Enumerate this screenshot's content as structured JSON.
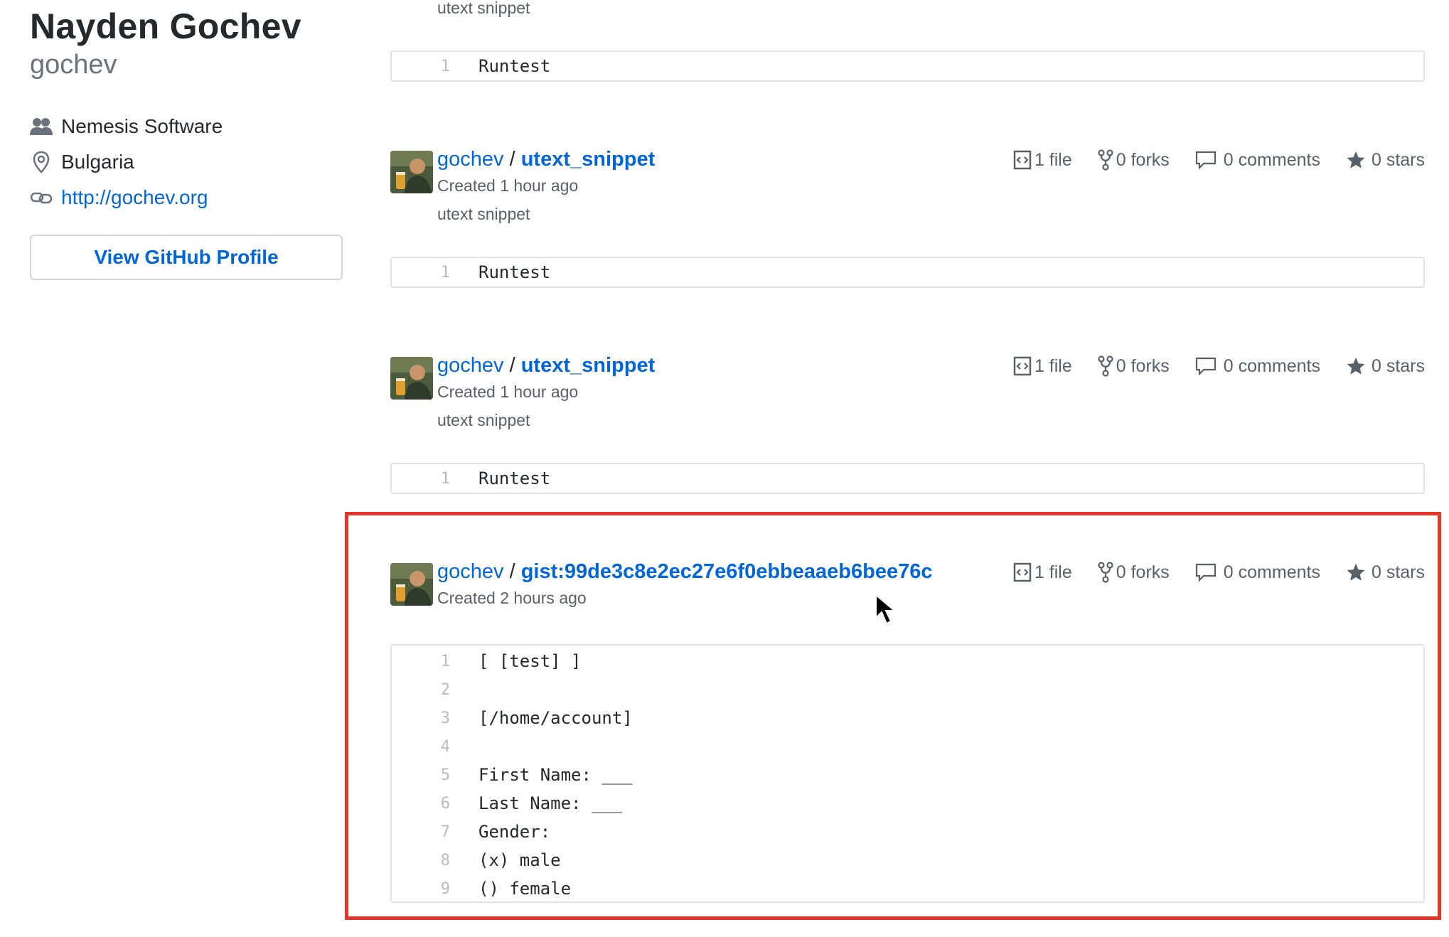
{
  "profile": {
    "full_name": "Nayden Gochev",
    "username": "gochev",
    "company": "Nemesis Software",
    "location": "Bulgaria",
    "website": "http://gochev.org",
    "view_button": "View GitHub Profile"
  },
  "top_partial": {
    "description": "utext snippet",
    "code": [
      {
        "n": "1",
        "text": "Runtest"
      }
    ]
  },
  "gists": [
    {
      "owner": "gochev",
      "separator": "/",
      "name": "utext_snippet",
      "created": "Created 1 hour ago",
      "description": "utext snippet",
      "files": "1 file",
      "forks": "0 forks",
      "comments": "0 comments",
      "stars": "0 stars",
      "code": [
        {
          "n": "1",
          "text": "Runtest"
        }
      ]
    },
    {
      "owner": "gochev",
      "separator": "/",
      "name": "utext_snippet",
      "created": "Created 1 hour ago",
      "description": "utext snippet",
      "files": "1 file",
      "forks": "0 forks",
      "comments": "0 comments",
      "stars": "0 stars",
      "code": [
        {
          "n": "1",
          "text": "Runtest"
        }
      ]
    },
    {
      "owner": "gochev",
      "separator": "/",
      "name": "gist:99de3c8e2ec27e6f0ebbeaaeb6bee76c",
      "created": "Created 2 hours ago",
      "files": "1 file",
      "forks": "0 forks",
      "comments": "0 comments",
      "stars": "0 stars",
      "code": [
        {
          "n": "1",
          "text": "[ [test] ]"
        },
        {
          "n": "2",
          "text": ""
        },
        {
          "n": "3",
          "text": "[/home/account]"
        },
        {
          "n": "4",
          "text": ""
        },
        {
          "n": "5",
          "text": "First Name: ___"
        },
        {
          "n": "6",
          "text": "Last Name: ___"
        },
        {
          "n": "7",
          "text": "Gender:"
        },
        {
          "n": "8",
          "text": "(x) male"
        },
        {
          "n": "9",
          "text": "() female"
        }
      ]
    }
  ],
  "colors": {
    "link": "#0366d6",
    "highlight_border": "#e5362a",
    "muted_text": "#586069"
  },
  "icons": [
    "people-icon",
    "location-icon",
    "link-icon",
    "code-file-icon",
    "fork-icon",
    "comment-icon",
    "star-icon",
    "mouse-cursor-icon"
  ]
}
